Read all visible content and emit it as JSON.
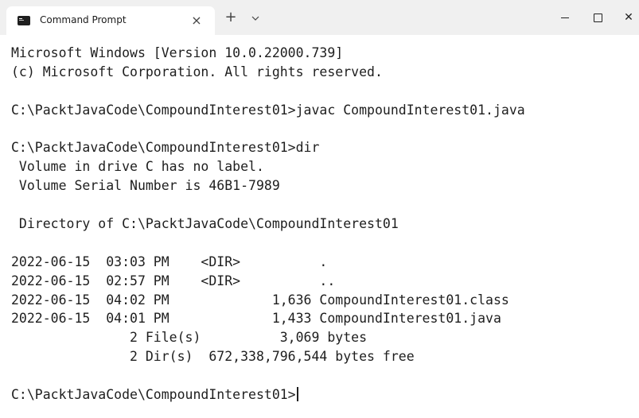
{
  "window": {
    "tab_title": "Command Prompt",
    "tab_close_icon": "close-icon",
    "new_tab_icon": "plus-icon",
    "dropdown_icon": "chevron-down-icon",
    "minimize_icon": "minimize-icon",
    "maximize_icon": "maximize-icon",
    "close_icon": "close-icon"
  },
  "terminal": {
    "lines": [
      "Microsoft Windows [Version 10.0.22000.739]",
      "(c) Microsoft Corporation. All rights reserved.",
      "",
      "C:\\PacktJavaCode\\CompoundInterest01>javac CompoundInterest01.java",
      "",
      "C:\\PacktJavaCode\\CompoundInterest01>dir",
      " Volume in drive C has no label.",
      " Volume Serial Number is 46B1-7989",
      "",
      " Directory of C:\\PacktJavaCode\\CompoundInterest01",
      "",
      "2022-06-15  03:03 PM    <DIR>          .",
      "2022-06-15  02:57 PM    <DIR>          ..",
      "2022-06-15  04:02 PM             1,636 CompoundInterest01.class",
      "2022-06-15  04:01 PM             1,433 CompoundInterest01.java",
      "               2 File(s)          3,069 bytes",
      "               2 Dir(s)  672,338,796,544 bytes free",
      "",
      "C:\\PacktJavaCode\\CompoundInterest01>"
    ]
  }
}
